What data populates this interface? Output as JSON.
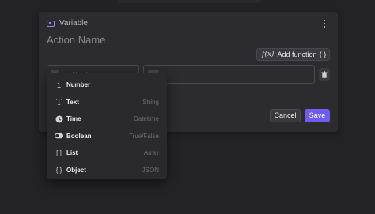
{
  "header": {
    "label": "Variable",
    "icon": "variable-icon"
  },
  "action_name_placeholder": "Action Name",
  "toolbar": {
    "add_function_label": "Add function",
    "fn_glyph": "f(x)",
    "braces_glyph": "{ }"
  },
  "type_select": {
    "placeholder": "myNumber"
  },
  "buttons": {
    "cancel": "Cancel",
    "save": "Save"
  },
  "colors": {
    "accent": "#6f5cf0",
    "accent_icon": "#8f87ff",
    "background": "#232325",
    "panel": "#2c2c2f"
  },
  "menu": {
    "items": [
      {
        "label": "Number",
        "type": "",
        "icon": "number-icon",
        "glyph": "1"
      },
      {
        "label": "Text",
        "type": "String",
        "icon": "text-icon",
        "glyph": "T"
      },
      {
        "label": "Time",
        "type": "Datetime",
        "icon": "clock-icon",
        "glyph": ""
      },
      {
        "label": "Boolean",
        "type": "True/False",
        "icon": "toggle-icon",
        "glyph": ""
      },
      {
        "label": "List",
        "type": "Array",
        "icon": "list-brackets-icon",
        "glyph": "[ ]"
      },
      {
        "label": "Object",
        "type": "JSON",
        "icon": "object-braces-icon",
        "glyph": "{ }"
      }
    ]
  }
}
